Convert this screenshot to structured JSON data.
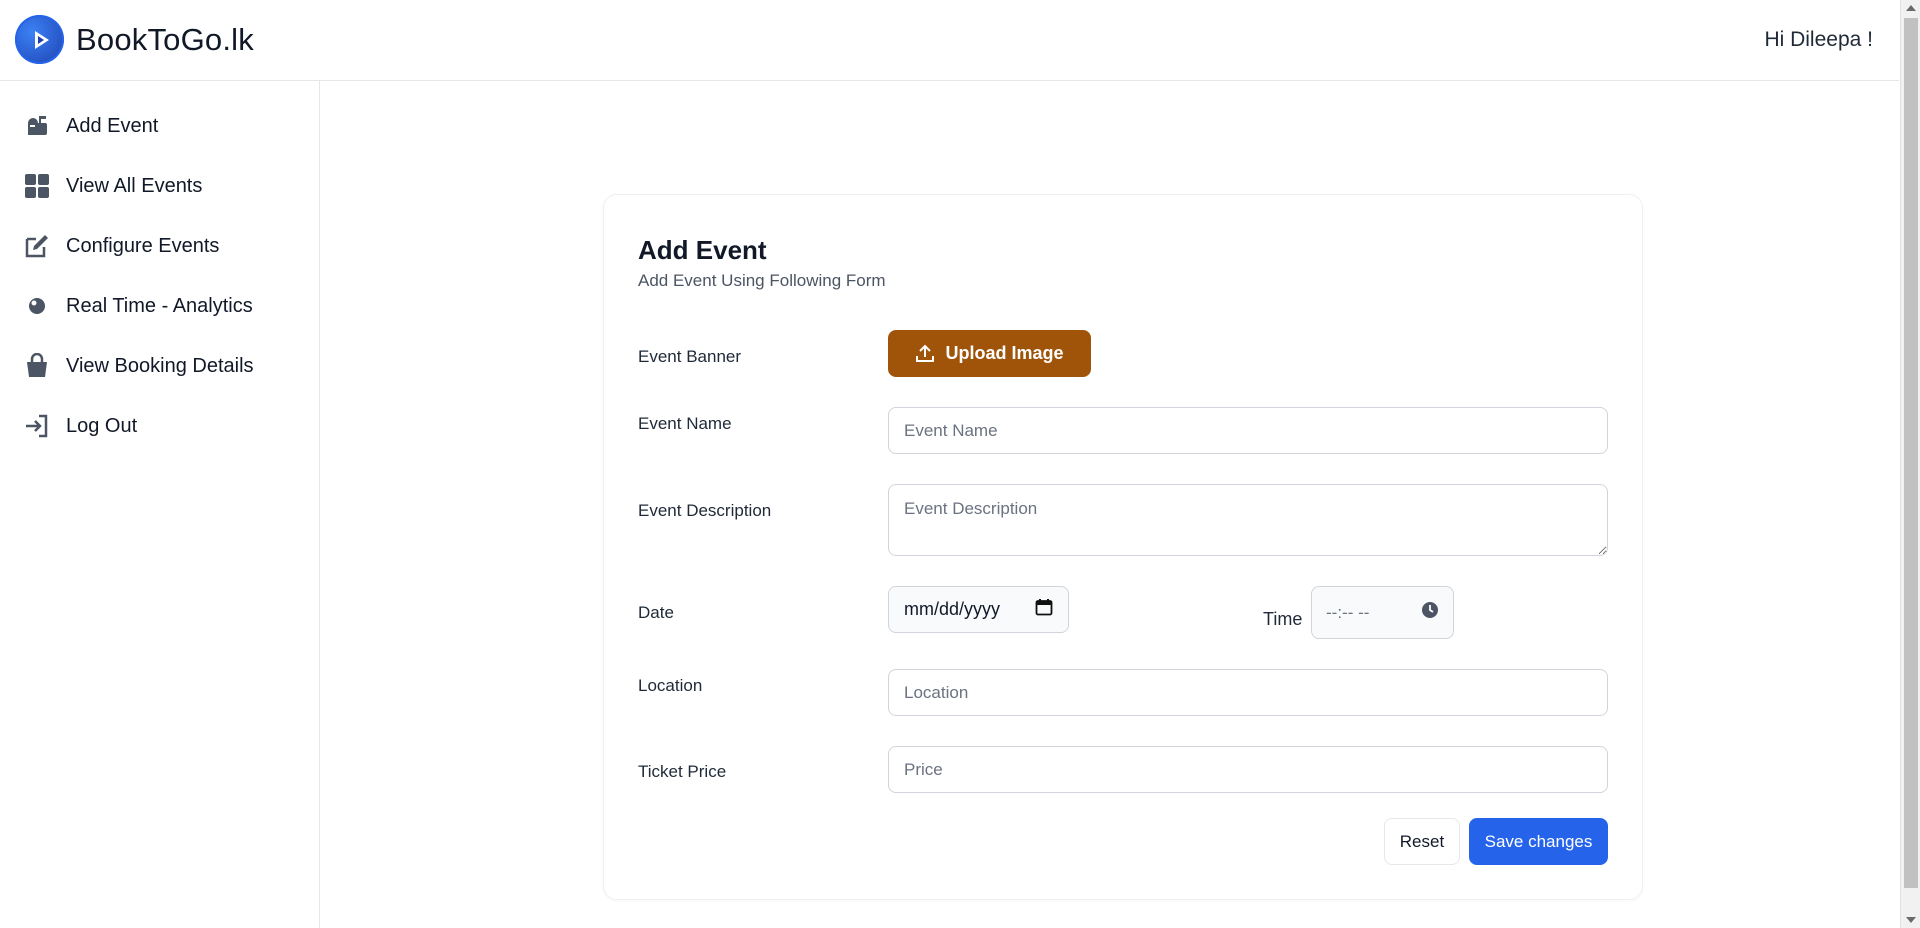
{
  "header": {
    "brand_name": "BookToGo.lk",
    "greeting": "Hi Dileepa !"
  },
  "sidebar": {
    "items": [
      {
        "label": "Add Event",
        "icon": "mailbox-icon"
      },
      {
        "label": "View All Events",
        "icon": "grid-icon"
      },
      {
        "label": "Configure Events",
        "icon": "edit-icon"
      },
      {
        "label": "Real Time - Analytics",
        "icon": "analytics-icon"
      },
      {
        "label": "View Booking Details",
        "icon": "bag-icon"
      },
      {
        "label": "Log Out",
        "icon": "logout-icon"
      }
    ]
  },
  "form": {
    "title": "Add Event",
    "subtitle": "Add Event Using Following Form",
    "banner_label": "Event Banner",
    "upload_label": "Upload Image",
    "name_label": "Event Name",
    "name_placeholder": "Event Name",
    "description_label": "Event Description",
    "description_placeholder": "Event Description",
    "date_label": "Date",
    "date_value": "mm/dd/yyyy",
    "time_label": "Time",
    "time_value": "--:-- --",
    "location_label": "Location",
    "location_placeholder": "Location",
    "price_label": "Ticket Price",
    "price_placeholder": "Price",
    "reset_label": "Reset",
    "save_label": "Save changes"
  },
  "colors": {
    "upload_button": "#a0540a",
    "save_button": "#2563eb",
    "logo": "#2563eb"
  }
}
